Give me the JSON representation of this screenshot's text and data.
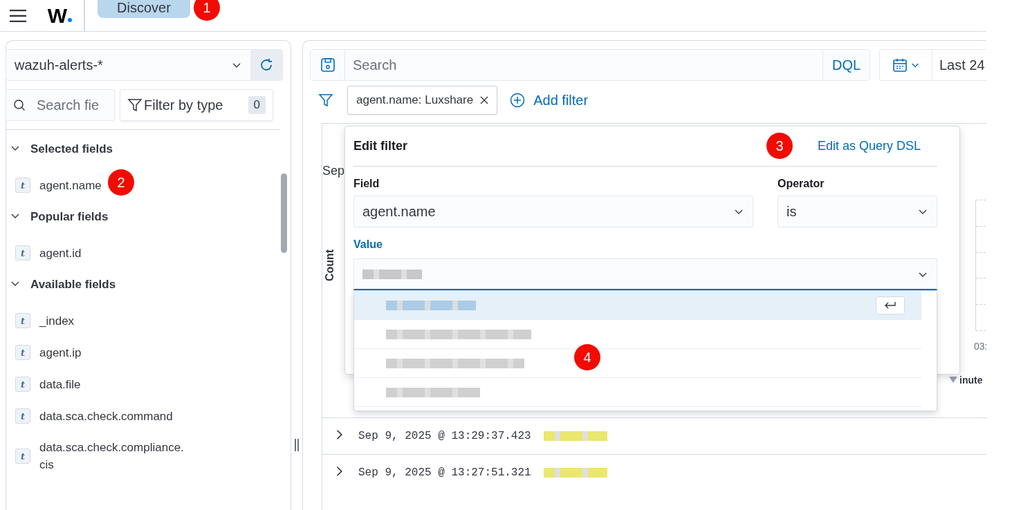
{
  "header": {
    "logo": "W",
    "app_title": "Discover"
  },
  "annotations": [
    "1",
    "2",
    "3",
    "4"
  ],
  "sidebar": {
    "index_pattern": "wazuh-alerts-*",
    "search": {
      "placeholder": "Search fie"
    },
    "filter_by_type": {
      "label": "Filter by type",
      "count": "0"
    },
    "sections": [
      {
        "title": "Selected fields",
        "expanded": true,
        "fields": [
          {
            "type": "t",
            "name": "agent.name"
          }
        ]
      },
      {
        "title": "Popular fields",
        "expanded": true,
        "fields": [
          {
            "type": "t",
            "name": "agent.id"
          }
        ]
      },
      {
        "title": "Available fields",
        "expanded": true,
        "fields": [
          {
            "type": "t",
            "name": "_index"
          },
          {
            "type": "t",
            "name": "agent.ip"
          },
          {
            "type": "t",
            "name": "data.file"
          },
          {
            "type": "t",
            "name": "data.sca.check.command"
          },
          {
            "type": "t",
            "name": "data.sca.check.compliance.\ncis"
          }
        ]
      }
    ]
  },
  "query_bar": {
    "placeholder": "Search",
    "language": "DQL",
    "time_range": "Last 24"
  },
  "filters": [
    {
      "label": "agent.name: Luxshare"
    }
  ],
  "add_filter": "Add filter",
  "chart": {
    "title": "Sep",
    "ylabel": "Count",
    "xtick": "03:",
    "interval": "inute"
  },
  "edit_filter": {
    "title": "Edit filter",
    "dsl_link": "Edit as Query DSL",
    "field_label": "Field",
    "field_value": "agent.name",
    "operator_label": "Operator",
    "operator_value": "is",
    "value_label": "Value",
    "options": [
      {
        "selected": true
      },
      {
        "selected": false
      },
      {
        "selected": false
      },
      {
        "selected": false
      }
    ]
  },
  "documents": [
    {
      "timestamp": "Sep 9, 2025 @ 13:29:37.423",
      "expanded": false
    },
    {
      "timestamp": "Sep 9, 2025 @ 13:27:51.321",
      "expanded": false
    }
  ]
}
